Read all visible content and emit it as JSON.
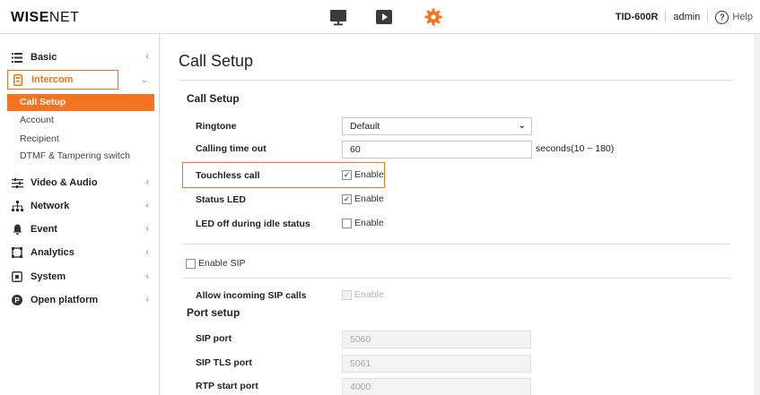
{
  "header": {
    "logo_bold": "WISE",
    "logo_thin": "NET",
    "model": "TID-600R",
    "user": "admin",
    "help_label": "Help",
    "accent_color": "#f37321"
  },
  "sidebar": {
    "items": [
      {
        "label": "Basic",
        "icon": "list-icon"
      },
      {
        "label": "Intercom",
        "icon": "intercom-icon"
      },
      {
        "label": "Video & Audio",
        "icon": "sliders-icon"
      },
      {
        "label": "Network",
        "icon": "network-icon"
      },
      {
        "label": "Event",
        "icon": "bell-icon"
      },
      {
        "label": "Analytics",
        "icon": "analytics-icon"
      },
      {
        "label": "System",
        "icon": "system-icon"
      },
      {
        "label": "Open platform",
        "icon": "open-platform-icon"
      }
    ],
    "subitems": [
      "Call Setup",
      "Account",
      "Recipient",
      "DTMF & Tampering switch"
    ]
  },
  "main": {
    "title": "Call Setup",
    "call_setup": {
      "section": "Call Setup",
      "ringtone_label": "Ringtone",
      "ringtone_value": "Default",
      "timeout_label": "Calling time out",
      "timeout_value": "60",
      "timeout_note": "seconds(10 ~ 180)",
      "touchless_label": "Touchless call",
      "touchless_checked": true,
      "status_led_label": "Status LED",
      "status_led_checked": true,
      "led_off_label": "LED off during idle status",
      "led_off_checked": false,
      "enable_text": "Enable"
    },
    "sip": {
      "enable_sip_label": "Enable SIP",
      "enable_sip_checked": false,
      "allow_incoming_label": "Allow incoming SIP calls",
      "allow_enable_text": "Enable"
    },
    "port_setup": {
      "section": "Port setup",
      "sip_port_label": "SIP port",
      "sip_port_value": "5060",
      "sip_tls_port_label": "SIP TLS port",
      "sip_tls_port_value": "5061",
      "rtp_start_port_label": "RTP start port",
      "rtp_start_port_value": "4000"
    }
  }
}
